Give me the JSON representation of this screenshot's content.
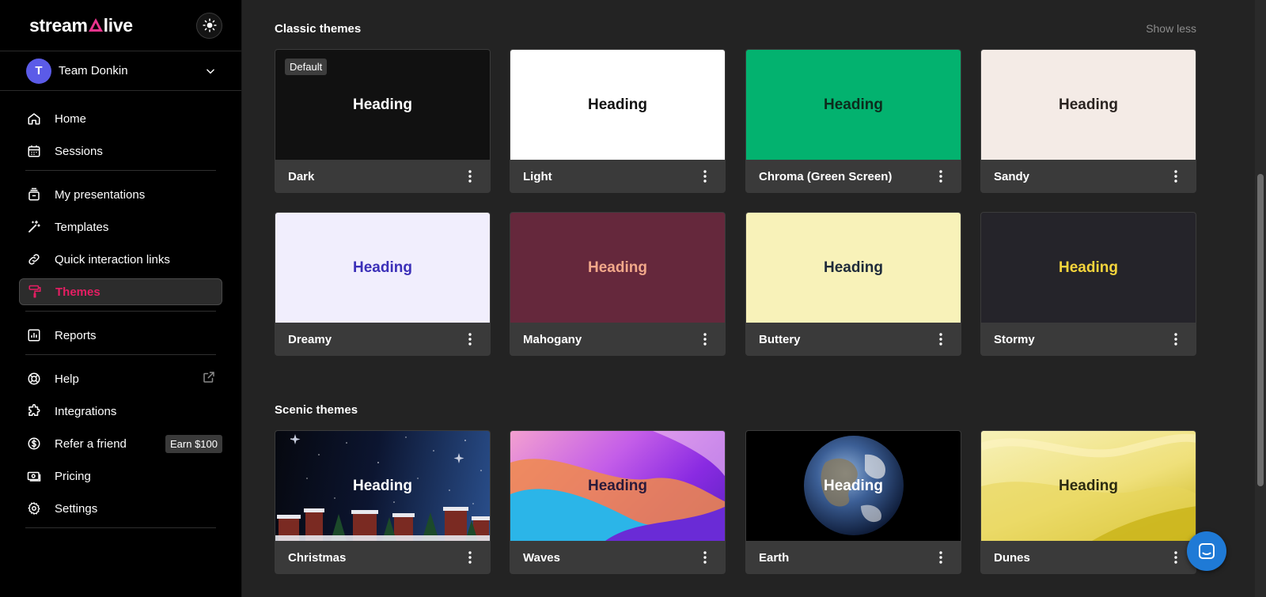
{
  "brand": {
    "logo_pre": "stream",
    "logo_post": "live"
  },
  "team": {
    "initial": "T",
    "name": "Team Donkin"
  },
  "nav": {
    "home": "Home",
    "sessions": "Sessions",
    "my_presentations": "My presentations",
    "templates": "Templates",
    "quick_links": "Quick interaction links",
    "themes": "Themes",
    "reports": "Reports",
    "help": "Help",
    "integrations": "Integrations",
    "refer": "Refer a friend",
    "refer_badge": "Earn $100",
    "pricing": "Pricing",
    "settings": "Settings"
  },
  "classic": {
    "title": "Classic themes",
    "toggle": "Show less",
    "default_badge": "Default",
    "cards": [
      {
        "name": "Dark",
        "heading": "Heading",
        "bg": "#111111",
        "fg": "#ffffff"
      },
      {
        "name": "Light",
        "heading": "Heading",
        "bg": "#ffffff",
        "fg": "#111111"
      },
      {
        "name": "Chroma (Green Screen)",
        "heading": "Heading",
        "bg": "#03b26f",
        "fg": "#0d2b1c"
      },
      {
        "name": "Sandy",
        "heading": "Heading",
        "bg": "#f4ebe6",
        "fg": "#2a2320"
      },
      {
        "name": "Dreamy",
        "heading": "Heading",
        "bg": "#f1eefd",
        "fg": "#3b2fb8"
      },
      {
        "name": "Mahogany",
        "heading": "Heading",
        "bg": "#65283c",
        "fg": "#f2a88a"
      },
      {
        "name": "Buttery",
        "heading": "Heading",
        "bg": "#f8f2b9",
        "fg": "#1e2a3a"
      },
      {
        "name": "Stormy",
        "heading": "Heading",
        "bg": "#25242a",
        "fg": "#f5d53c"
      }
    ]
  },
  "scenic": {
    "title": "Scenic themes",
    "cards": [
      {
        "name": "Christmas",
        "heading": "Heading",
        "fg": "#ffffff"
      },
      {
        "name": "Waves",
        "heading": "Heading",
        "fg": "#2a1a3a"
      },
      {
        "name": "Earth",
        "heading": "Heading",
        "fg": "#ffffff"
      },
      {
        "name": "Dunes",
        "heading": "Heading",
        "fg": "#2b2a10"
      }
    ]
  },
  "colors": {
    "accent": "#e51e63",
    "chat": "#1f7ad6"
  }
}
